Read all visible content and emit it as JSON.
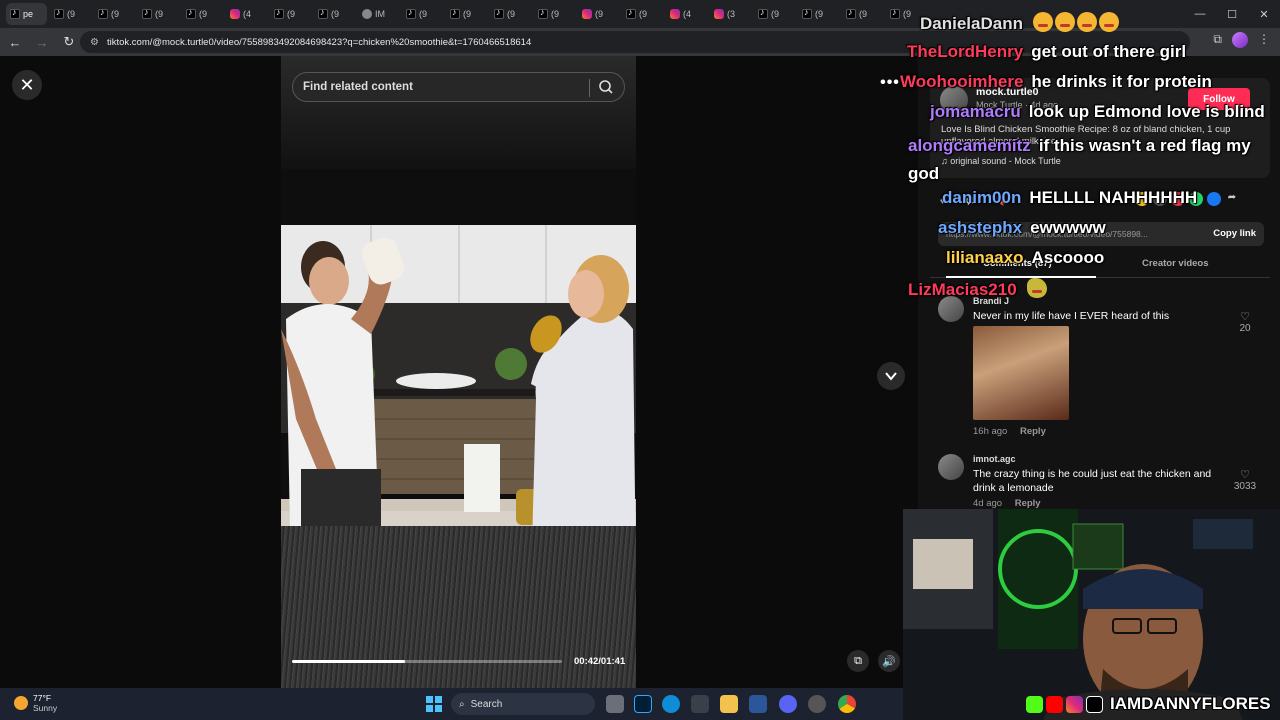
{
  "browser": {
    "tabs": [
      {
        "icon": "tiktok",
        "label": "pe"
      },
      {
        "icon": "tiktok",
        "label": "(9"
      },
      {
        "icon": "tiktok",
        "label": "(9"
      },
      {
        "icon": "tiktok",
        "label": "(9"
      },
      {
        "icon": "tiktok",
        "label": "(9"
      },
      {
        "icon": "instagram",
        "label": "(4"
      },
      {
        "icon": "tiktok",
        "label": "(9"
      },
      {
        "icon": "tiktok",
        "label": "(9"
      },
      {
        "icon": "globe",
        "label": "IM"
      },
      {
        "icon": "tiktok",
        "label": "(9"
      },
      {
        "icon": "tiktok",
        "label": "(9"
      },
      {
        "icon": "tiktok",
        "label": "(9"
      },
      {
        "icon": "tiktok",
        "label": "(9"
      },
      {
        "icon": "instagram",
        "label": "(9"
      },
      {
        "icon": "tiktok",
        "label": "(9"
      },
      {
        "icon": "instagram",
        "label": "(4"
      },
      {
        "icon": "instagram",
        "label": "(3"
      },
      {
        "icon": "tiktok",
        "label": "(9"
      },
      {
        "icon": "tiktok",
        "label": "(9"
      },
      {
        "icon": "tiktok",
        "label": "(9"
      },
      {
        "icon": "tiktok",
        "label": "(9"
      }
    ],
    "url": "tiktok.com/@mock.turtle0/video/7558983492084698423?q=chicken%20smoothie&t=1760466518614"
  },
  "player": {
    "search_placeholder": "Find related content",
    "time": "00:42/01:41",
    "progress": 0.42
  },
  "post": {
    "author": "mock.turtle0",
    "author_sub": "Mock Turtle · 4d ago",
    "follow_label": "Follow",
    "description": "Love Is Blind Chicken Smoothie Recipe: 8 oz of bland chicken, 1 cup unflavored almond milk, ice",
    "sound": "original sound - Mock Turtle",
    "link": "https://www.tiktok.com/@mock.turtle0/video/755898...",
    "copy_link_label": "Copy link"
  },
  "tabs": {
    "comments_label": "Comments (87)",
    "creator_videos_label": "Creator videos"
  },
  "comments": [
    {
      "user": "Brandi J",
      "text": "Never in my life have I EVER heard of this",
      "time": "16h ago",
      "reply": "Reply",
      "likes": "20"
    },
    {
      "user": "imnot.agc",
      "text": "The crazy thing is he could just eat the chicken and drink a lemonade",
      "time": "4d ago",
      "reply": "Reply",
      "likes": "3033"
    }
  ],
  "chat": [
    {
      "user": "DanielaDann",
      "color": "#e0e0e0",
      "message": "",
      "emotes": 4
    },
    {
      "user": "TheLordHenry",
      "color": "#ff3b5c",
      "message": "get out of there girl",
      "emotes": 0
    },
    {
      "user": "Woohooimhere",
      "color": "#ff3b5c",
      "message": "he drinks it for protein",
      "emotes": 0
    },
    {
      "user": "jomamacru",
      "color": "#b07cff",
      "message": "look up Edmond love is blind",
      "emotes": 0
    },
    {
      "user": "alongcamemitz",
      "color": "#b07cff",
      "message": "if this wasn't a red flag my god",
      "emotes": 0
    },
    {
      "user": "danim00n",
      "color": "#6ea8ff",
      "message": "HELLLL NAHHHHHH",
      "emotes": 0
    },
    {
      "user": "ashstephx",
      "color": "#6ea8ff",
      "message": "ewwwww",
      "emotes": 0
    },
    {
      "user": "lilianaaxo",
      "color": "#ffd24a",
      "message": "Ascoooo",
      "emotes": 0
    },
    {
      "user": "LizMacias210",
      "color": "#ff3b5c",
      "message": "",
      "emotes": 1
    }
  ],
  "stream": {
    "handle": "IAMDANNYFLORES"
  },
  "taskbar": {
    "temperature": "77°F",
    "condition": "Sunny",
    "search_label": "Search"
  }
}
